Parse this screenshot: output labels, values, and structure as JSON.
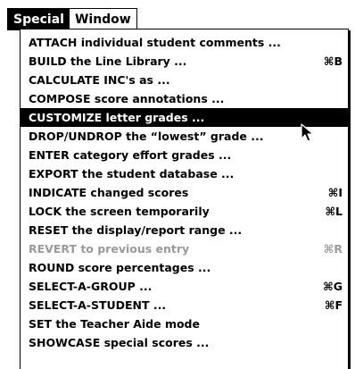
{
  "menubar": {
    "items": [
      {
        "label": "Special",
        "active": true
      },
      {
        "label": "Window",
        "active": false
      }
    ]
  },
  "menu": {
    "items": [
      {
        "label": "ATTACH individual student comments ...",
        "shortcut": ""
      },
      {
        "label": "BUILD the Line Library ...",
        "shortcut": "⌘B"
      },
      {
        "label": "CALCULATE INC's as ...",
        "shortcut": ""
      },
      {
        "label": "COMPOSE score annotations ...",
        "shortcut": ""
      },
      {
        "label": "CUSTOMIZE letter grades ...",
        "shortcut": "",
        "highlighted": true
      },
      {
        "label": "DROP/UNDROP the “lowest” grade ...",
        "shortcut": ""
      },
      {
        "label": "ENTER category effort grades ...",
        "shortcut": ""
      },
      {
        "label": "EXPORT the student database ...",
        "shortcut": ""
      },
      {
        "label": "INDICATE changed scores",
        "shortcut": "⌘I"
      },
      {
        "label": "LOCK the screen temporarily",
        "shortcut": "⌘L"
      },
      {
        "label": "RESET the display/report range ...",
        "shortcut": ""
      },
      {
        "label": "REVERT to previous entry",
        "shortcut": "⌘R",
        "disabled": true
      },
      {
        "label": "ROUND score percentages ...",
        "shortcut": ""
      },
      {
        "label": "SELECT-A-GROUP ...",
        "shortcut": "⌘G"
      },
      {
        "label": "SELECT-A-STUDENT ...",
        "shortcut": "⌘F"
      },
      {
        "label": "SET the Teacher Aide mode",
        "shortcut": ""
      },
      {
        "label": "SHOWCASE special scores ...",
        "shortcut": ""
      }
    ]
  },
  "cursor": {
    "icon": "arrow-pointer-icon"
  },
  "colors": {
    "highlight": "#000000",
    "disabled_text": "#9a9a9a",
    "background": "#ffffff"
  }
}
